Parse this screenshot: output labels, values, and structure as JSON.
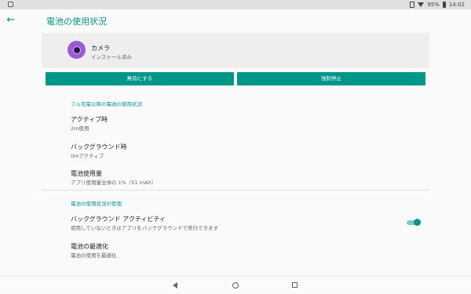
{
  "status_bar": {
    "battery_percent": "95%",
    "time": "14:02"
  },
  "app_bar": {
    "title": "電池の使用状況"
  },
  "app_info": {
    "name": "カメラ",
    "status": "インストール済み"
  },
  "buttons": {
    "disable": "無効にする",
    "force_stop": "強制停止"
  },
  "section1": {
    "header": "フル充電以降の電池の使用状況",
    "items": [
      {
        "title": "アクティブ時",
        "subtitle": "2m使用"
      },
      {
        "title": "バックグラウンド時",
        "subtitle": "0mアクティブ"
      },
      {
        "title": "電池使用量",
        "subtitle": "アプリ使用量全体の 1%（51 mAh）"
      }
    ]
  },
  "section2": {
    "header": "電池の使用状況の管理",
    "items": [
      {
        "title": "バックグラウンド アクティビティ",
        "subtitle": "使用していないときはアプリをバックグラウンドで実行できます",
        "toggle_on": true
      },
      {
        "title": "電池の最適化",
        "subtitle": "電池の使用を最適化"
      }
    ]
  },
  "colors": {
    "accent": "#009688",
    "app_icon": "#9b59d8"
  }
}
